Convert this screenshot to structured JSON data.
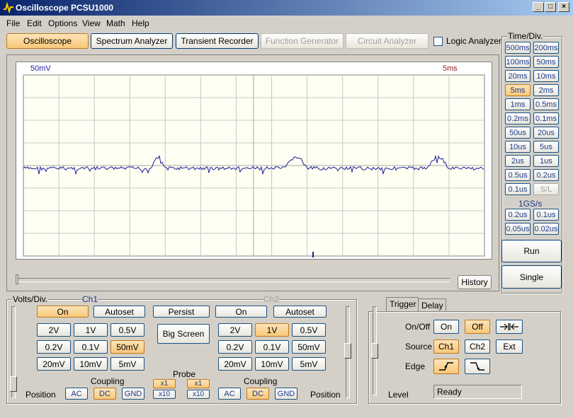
{
  "window": {
    "title": "Oscilloscope PCSU1000",
    "min": "_",
    "max": "□",
    "close": "×"
  },
  "menu": [
    "File",
    "Edit",
    "Options",
    "View",
    "Math",
    "Help"
  ],
  "modes": {
    "oscilloscope": "Oscilloscope",
    "spectrum": "Spectrum Analyzer",
    "transient": "Transient Recorder",
    "function_gen": "Function Generator",
    "circuit": "Circuit Analyzer",
    "logic": "Logic Analyzer"
  },
  "screen": {
    "volts_label": "50mV",
    "time_label": "5ms",
    "history": "History"
  },
  "timediv": {
    "title": "Time/Div.",
    "buttons": [
      "500ms",
      "200ms",
      "100ms",
      "50ms",
      "20ms",
      "10ms",
      "5ms",
      "2ms",
      "1ms",
      "0.5ms",
      "0.2ms",
      "0.1ms",
      "50us",
      "20us",
      "10us",
      "5us",
      "2us",
      "1us",
      "0.5us",
      "0.2us",
      "0.1us",
      "S/L"
    ],
    "rate": "1GS/s",
    "extra": [
      "0.2us",
      "0.1us",
      "0.05us",
      "0.02us"
    ],
    "selected": "5ms",
    "run": "Run",
    "single": "Single"
  },
  "volts": {
    "title": "Volts/Div.",
    "ch1": "Ch1",
    "ch2": "Ch2",
    "on": "On",
    "autoset": "Autoset",
    "persist": "Persist",
    "big_screen": "Big Screen",
    "ranges": [
      "2V",
      "1V",
      "0.5V",
      "0.2V",
      "0.1V",
      "50mV",
      "20mV",
      "10mV",
      "5mV"
    ],
    "ch1_selected": "50mV",
    "ch2_selected": "1V",
    "coupling": "Coupling",
    "probe": "Probe",
    "ac": "AC",
    "dc": "DC",
    "gnd": "GND",
    "x1": "x1",
    "x10": "x10",
    "position": "Position"
  },
  "trigger": {
    "tab_trigger": "Trigger",
    "tab_delay": "Delay",
    "onoff": "On/Off",
    "on": "On",
    "off": "Off",
    "source": "Source",
    "ch1": "Ch1",
    "ch2": "Ch2",
    "ext": "Ext",
    "edge": "Edge",
    "level": "Level",
    "status": "Ready"
  }
}
